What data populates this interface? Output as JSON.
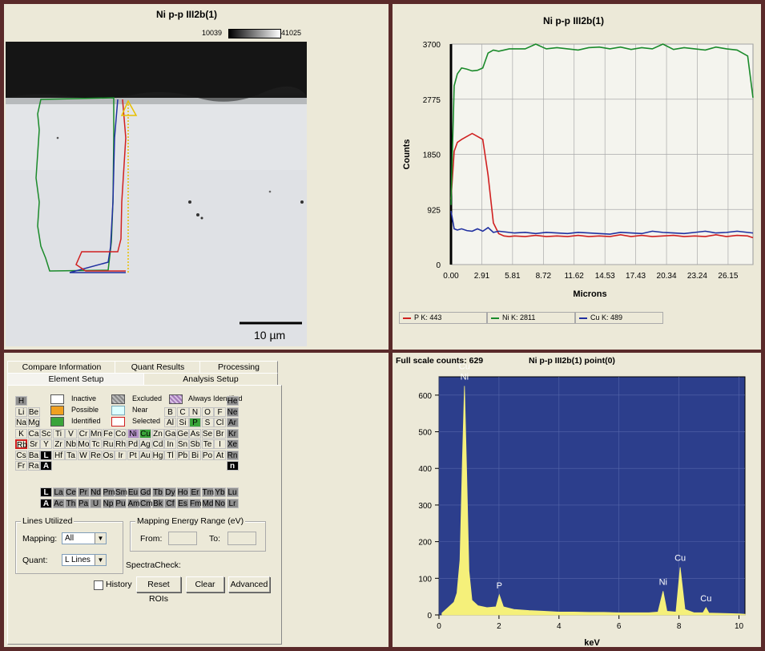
{
  "image_panel": {
    "title": "Ni p-p III2b(1)",
    "scale_min": "10039",
    "scale_max": "41025",
    "scale_bar_label": "10 µm"
  },
  "linescan": {
    "title": "Ni p-p III2b(1)",
    "legend": [
      {
        "label": "P K: 443",
        "color": "#d02020"
      },
      {
        "label": "Ni K: 2811",
        "color": "#1a8a2a"
      },
      {
        "label": "Cu K: 489",
        "color": "#2030a0"
      }
    ]
  },
  "element_setup": {
    "tabs_row1": [
      "Compare Information",
      "Quant Results",
      "Processing"
    ],
    "tabs_row2": [
      "Element Setup",
      "Analysis Setup"
    ],
    "legend": {
      "inactive": "Inactive",
      "possible": "Possible",
      "identified": "Identified",
      "excluded": "Excluded",
      "near": "Near",
      "selected": "Selected",
      "always": "Always Identified"
    },
    "periodic_rows": [
      [
        "H",
        "",
        "",
        "",
        "",
        "",
        "",
        "",
        "",
        "",
        "",
        "",
        "",
        "",
        "",
        "",
        "",
        "He"
      ],
      [
        "Li",
        "Be",
        "",
        "",
        "",
        "",
        "",
        "",
        "",
        "",
        "",
        "",
        "B",
        "C",
        "N",
        "O",
        "F",
        "Ne"
      ],
      [
        "Na",
        "Mg",
        "",
        "",
        "",
        "",
        "",
        "",
        "",
        "",
        "",
        "",
        "Al",
        "Si",
        "P",
        "S",
        "Cl",
        "Ar"
      ],
      [
        "K",
        "Ca",
        "Sc",
        "Ti",
        "V",
        "Cr",
        "Mn",
        "Fe",
        "Co",
        "Ni",
        "Cu",
        "Zn",
        "Ga",
        "Ge",
        "As",
        "Se",
        "Br",
        "Kr"
      ],
      [
        "Rb",
        "Sr",
        "Y",
        "Zr",
        "Nb",
        "Mo",
        "Tc",
        "Ru",
        "Rh",
        "Pd",
        "Ag",
        "Cd",
        "In",
        "Sn",
        "Sb",
        "Te",
        "I",
        "Xe"
      ],
      [
        "Cs",
        "Ba",
        "L",
        "Hf",
        "Ta",
        "W",
        "Re",
        "Os",
        "Ir",
        "Pt",
        "Au",
        "Hg",
        "Tl",
        "Pb",
        "Bi",
        "Po",
        "At",
        "Rn"
      ],
      [
        "Fr",
        "Ra",
        "A",
        "",
        "",
        "",
        "",
        "",
        "",
        "",
        "",
        "",
        "",
        "",
        "",
        "",
        "",
        "n"
      ]
    ],
    "lanthanides": [
      "L",
      "La",
      "Ce",
      "Pr",
      "Nd",
      "Pm",
      "Sm",
      "Eu",
      "Gd",
      "Tb",
      "Dy",
      "Ho",
      "Er",
      "Tm",
      "Yb",
      "Lu"
    ],
    "actinides": [
      "A",
      "Ac",
      "Th",
      "Pa",
      "U",
      "Np",
      "Pu",
      "Am",
      "Cm",
      "Bk",
      "Cf",
      "Es",
      "Fm",
      "Md",
      "No",
      "Lr"
    ],
    "lines_utilized": {
      "title": "Lines Utilized",
      "mapping_label": "Mapping:",
      "mapping_value": "All",
      "quant_label": "Quant:",
      "quant_value": "L Lines"
    },
    "mapping_energy": {
      "title": "Mapping Energy Range (eV)",
      "from_label": "From:",
      "to_label": "To:"
    },
    "spectracheck": "SpectraCheck:",
    "history_label": "History",
    "buttons": {
      "reset": "Reset ROIs",
      "clear": "Clear",
      "advanced": "Advanced"
    }
  },
  "spectrum": {
    "full_scale": "Full scale counts: 629",
    "title": "Ni p-p III2b(1) point(0)"
  },
  "chart_data": [
    {
      "type": "line",
      "title": "Ni p-p III2b(1)",
      "xlabel": "Microns",
      "ylabel": "Counts",
      "xlim": [
        0,
        28.5
      ],
      "ylim": [
        0,
        3700
      ],
      "xticks": [
        "0.00",
        "2.91",
        "5.81",
        "8.72",
        "11.62",
        "14.53",
        "17.43",
        "20.34",
        "23.24",
        "26.15"
      ],
      "yticks": [
        "0",
        "925",
        "1850",
        "2775",
        "3700"
      ],
      "x": [
        0,
        0.3,
        0.6,
        1,
        1.5,
        2,
        2.5,
        3,
        3.5,
        4,
        4.5,
        5,
        5.5,
        6,
        7,
        8,
        9,
        10,
        11,
        12,
        13,
        14,
        15,
        16,
        17,
        18,
        19,
        20,
        21,
        22,
        23,
        24,
        25,
        26,
        27,
        28,
        28.5
      ],
      "series": [
        {
          "name": "P K: 443",
          "color": "#d02020",
          "values": [
            1100,
            1900,
            2050,
            2100,
            2150,
            2200,
            2150,
            2100,
            1500,
            700,
            520,
            480,
            470,
            480,
            470,
            490,
            470,
            480,
            470,
            490,
            470,
            480,
            470,
            500,
            470,
            490,
            470,
            480,
            490,
            470,
            480,
            470,
            500,
            470,
            490,
            480,
            450
          ]
        },
        {
          "name": "Ni K: 2811",
          "color": "#1a8a2a",
          "values": [
            1000,
            3000,
            3200,
            3300,
            3280,
            3250,
            3260,
            3300,
            3550,
            3600,
            3580,
            3600,
            3620,
            3620,
            3620,
            3700,
            3620,
            3640,
            3620,
            3600,
            3640,
            3650,
            3620,
            3650,
            3610,
            3640,
            3620,
            3700,
            3610,
            3640,
            3620,
            3600,
            3650,
            3620,
            3600,
            3500,
            2800
          ]
        },
        {
          "name": "Cu K: 489",
          "color": "#2030a0",
          "values": [
            900,
            600,
            580,
            600,
            570,
            560,
            600,
            560,
            620,
            540,
            560,
            550,
            540,
            530,
            540,
            520,
            540,
            530,
            520,
            540,
            530,
            520,
            510,
            540,
            530,
            520,
            560,
            540,
            530,
            520,
            540,
            560,
            530,
            540,
            560,
            540,
            530
          ]
        }
      ]
    },
    {
      "type": "area",
      "title": "Ni p-p III2b(1) point(0)",
      "xlabel": "keV",
      "ylabel": "",
      "xlim": [
        0,
        10.2
      ],
      "ylim": [
        0,
        650
      ],
      "xticks": [
        "0",
        "2",
        "4",
        "6",
        "8",
        "10"
      ],
      "yticks": [
        "0",
        "100",
        "200",
        "300",
        "400",
        "500",
        "600"
      ],
      "peaks": [
        {
          "label": "Cu\nNi",
          "x": 0.85,
          "y": 625
        },
        {
          "label": "P",
          "x": 2.01,
          "y": 55
        },
        {
          "label": "Ni",
          "x": 7.47,
          "y": 65
        },
        {
          "label": "Cu",
          "x": 8.04,
          "y": 130
        },
        {
          "label": "Cu",
          "x": 8.9,
          "y": 20
        }
      ],
      "x": [
        0.1,
        0.3,
        0.5,
        0.6,
        0.7,
        0.78,
        0.85,
        0.92,
        1.0,
        1.1,
        1.3,
        1.6,
        1.9,
        2.01,
        2.15,
        2.5,
        3,
        3.5,
        4,
        4.5,
        5,
        5.5,
        6,
        6.5,
        7,
        7.3,
        7.47,
        7.6,
        7.9,
        8.04,
        8.2,
        8.5,
        8.8,
        8.9,
        9.0,
        9.5,
        10,
        10.2
      ],
      "series": [
        {
          "name": "",
          "color": "#f5f07a",
          "values": [
            5,
            20,
            35,
            60,
            150,
            420,
            625,
            400,
            120,
            40,
            25,
            20,
            22,
            55,
            22,
            15,
            12,
            10,
            8,
            8,
            7,
            7,
            6,
            6,
            6,
            8,
            65,
            10,
            8,
            130,
            15,
            6,
            6,
            20,
            5,
            4,
            3,
            2
          ]
        }
      ]
    }
  ]
}
